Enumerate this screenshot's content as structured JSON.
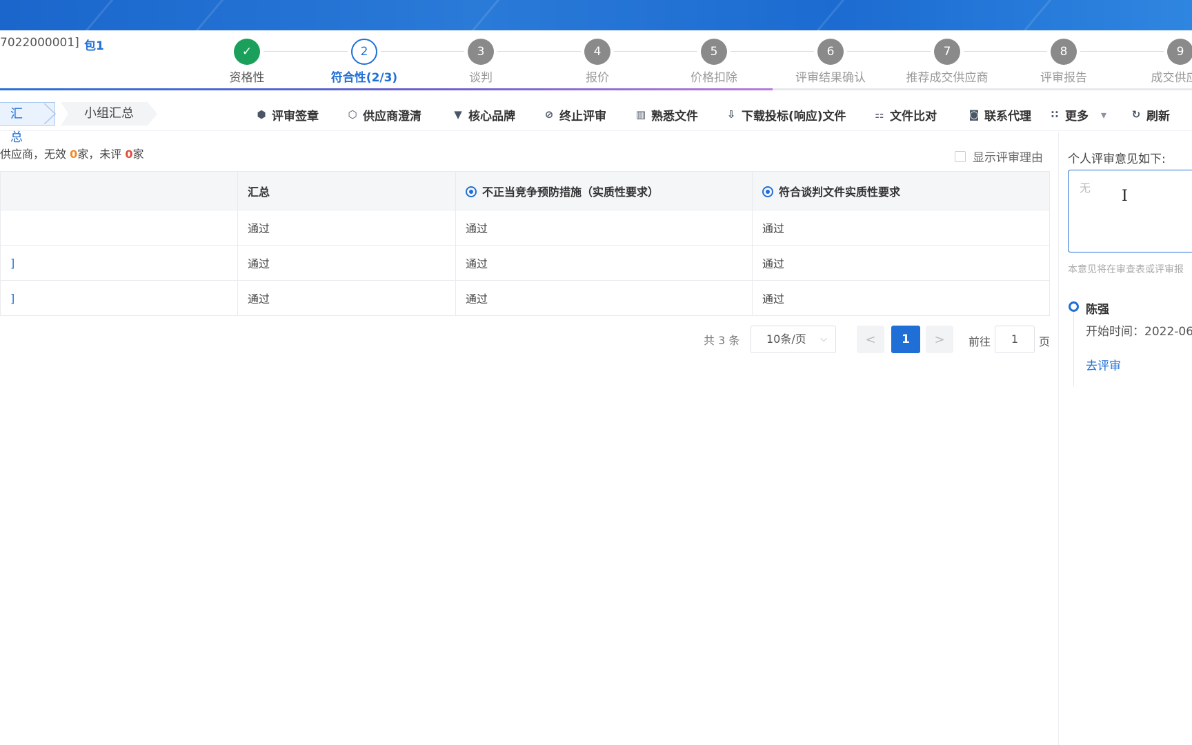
{
  "header": {
    "project_code": "7022000001]",
    "package": "包1"
  },
  "steps": [
    {
      "num": "✓",
      "label": "资格性",
      "state": "done"
    },
    {
      "num": "2",
      "label": "符合性(2/3)",
      "state": "active"
    },
    {
      "num": "3",
      "label": "谈判",
      "state": "todo"
    },
    {
      "num": "4",
      "label": "报价",
      "state": "todo"
    },
    {
      "num": "5",
      "label": "价格扣除",
      "state": "todo"
    },
    {
      "num": "6",
      "label": "评审结果确认",
      "state": "todo"
    },
    {
      "num": "7",
      "label": "推荐成交供应商",
      "state": "todo"
    },
    {
      "num": "8",
      "label": "评审报告",
      "state": "todo"
    },
    {
      "num": "9",
      "label": "成交供应商",
      "state": "todo"
    }
  ],
  "progress_fraction": 0.65,
  "breadcrumb": {
    "current": "汇总",
    "next": "小组汇总"
  },
  "toolbar": [
    {
      "icon": "seal-icon",
      "glyph": "⬢",
      "label": "评审签章"
    },
    {
      "icon": "supplier-clarify-icon",
      "glyph": "⬡",
      "label": "供应商澄清"
    },
    {
      "icon": "diamond-icon",
      "glyph": "▼",
      "label": "核心品牌"
    },
    {
      "icon": "stop-icon",
      "glyph": "⊘",
      "label": "终止评审"
    },
    {
      "icon": "bookshelf-icon",
      "glyph": "▥",
      "label": "熟悉文件"
    },
    {
      "icon": "download-icon",
      "glyph": "⇩",
      "label": "下载投标(响应)文件"
    },
    {
      "icon": "compare-icon",
      "glyph": "⚏",
      "label": "文件比对"
    },
    {
      "icon": "agent-icon",
      "glyph": "◙",
      "label": "联系代理"
    },
    {
      "icon": "grid-icon",
      "glyph": "∷",
      "label": "更多"
    },
    {
      "icon": "refresh-icon",
      "glyph": "↻",
      "label": "刷新"
    }
  ],
  "summary": {
    "prefix": "供应商，无效 ",
    "invalid_count": "0",
    "mid": "家，未评 ",
    "unreviewed_count": "0",
    "suffix": "家"
  },
  "show_reason_label": "显示评审理由",
  "table": {
    "headers": [
      "",
      "汇总",
      "不正当竞争预防措施（实质性要求）",
      "符合谈判文件实质性要求"
    ],
    "rows": [
      [
        "",
        "通过",
        "通过",
        "通过"
      ],
      [
        "]",
        "通过",
        "通过",
        "通过"
      ],
      [
        "]",
        "通过",
        "通过",
        "通过"
      ]
    ]
  },
  "pagination": {
    "total": "共 3 条",
    "page_size": "10条/页",
    "prev": "<",
    "current": "1",
    "next": ">",
    "goto_label": "前往",
    "goto_value": "1",
    "page_label": "页"
  },
  "side": {
    "title": "个人评审意见如下:",
    "placeholder": "无",
    "note": "本意见将在审查表或评审报",
    "reviewer": "陈强",
    "start_time": "开始时间：2022-06",
    "link": "去评审"
  },
  "colors": {
    "primary": "#1f6fd6",
    "success": "#1aa05a",
    "warning": "#f08a24",
    "danger": "#e04a3a"
  }
}
